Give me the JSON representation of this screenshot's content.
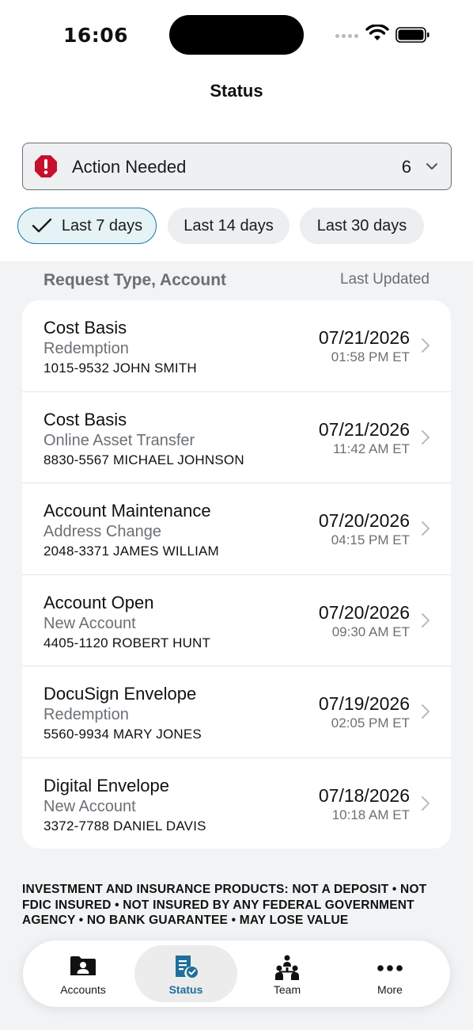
{
  "status_bar": {
    "time": "16:06"
  },
  "nav": {
    "title": "Status"
  },
  "filter": {
    "label": "Action Needed",
    "count": "6"
  },
  "chips": [
    {
      "label": "Last 7 days",
      "selected": true
    },
    {
      "label": "Last 14 days",
      "selected": false
    },
    {
      "label": "Last 30 days",
      "selected": false
    }
  ],
  "list_header": {
    "left": "Request Type, Account",
    "right": "Last Updated"
  },
  "requests": [
    {
      "type": "Cost Basis",
      "subtype": "Redemption",
      "account": "1015-9532 JOHN SMITH",
      "date": "07/21/2026",
      "time": "01:58 PM ET"
    },
    {
      "type": "Cost Basis",
      "subtype": "Online Asset Transfer",
      "account": "8830-5567 MICHAEL JOHNSON",
      "date": "07/21/2026",
      "time": "11:42 AM ET"
    },
    {
      "type": "Account Maintenance",
      "subtype": "Address Change",
      "account": "2048-3371 JAMES WILLIAM",
      "date": "07/20/2026",
      "time": "04:15 PM ET"
    },
    {
      "type": "Account Open",
      "subtype": "New Account",
      "account": "4405-1120 ROBERT HUNT",
      "date": "07/20/2026",
      "time": "09:30 AM ET"
    },
    {
      "type": "DocuSign Envelope",
      "subtype": "Redemption",
      "account": "5560-9934 MARY JONES",
      "date": "07/19/2026",
      "time": "02:05 PM ET"
    },
    {
      "type": "Digital Envelope",
      "subtype": "New Account",
      "account": "3372-7788 DANIEL DAVIS",
      "date": "07/18/2026",
      "time": "10:18 AM ET"
    }
  ],
  "disclaimer": "INVESTMENT AND INSURANCE PRODUCTS: NOT A DEPOSIT • NOT FDIC INSURED • NOT INSURED BY ANY FEDERAL GOVERNMENT AGENCY • NO BANK GUARANTEE • MAY LOSE VALUE",
  "tabs": [
    {
      "label": "Accounts",
      "icon": "folder-person-icon"
    },
    {
      "label": "Status",
      "icon": "status-document-check-icon"
    },
    {
      "label": "Team",
      "icon": "team-people-icon"
    },
    {
      "label": "More",
      "icon": "more-dots-icon"
    }
  ],
  "colors": {
    "accent": "#1f7fa6",
    "alert": "#c8102e",
    "background": "#f1f3f5"
  }
}
